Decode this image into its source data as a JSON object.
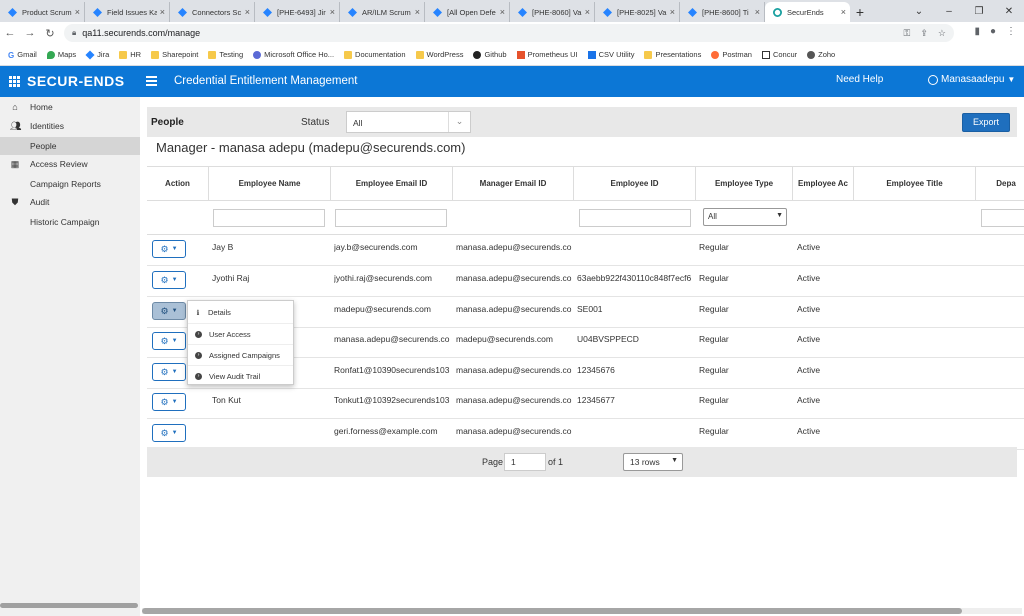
{
  "browser": {
    "tabs": [
      {
        "title": "Product Scrum"
      },
      {
        "title": "Field Issues Ka"
      },
      {
        "title": "Connectors Sc"
      },
      {
        "title": "[PHE-6493] Jir"
      },
      {
        "title": "AR/ILM Scrum"
      },
      {
        "title": "[All Open Defe"
      },
      {
        "title": "[PHE-8060] Va"
      },
      {
        "title": "[PHE-8025] Va"
      },
      {
        "title": "[PHE-8600] Ti"
      },
      {
        "title": "SecurEnds"
      }
    ],
    "url": "qa11.securends.com/manage",
    "bookmarks": [
      "Gmail",
      "Maps",
      "Jira",
      "HR",
      "Sharepoint",
      "Testing",
      "Microsoft Office Ho...",
      "Documentation",
      "WordPress",
      "Github",
      "Prometheus UI",
      "CSV Utility",
      "Presentations",
      "Postman",
      "Concur",
      "Zoho"
    ]
  },
  "header": {
    "logo": "SECUR-ENDS",
    "title": "Credential Entitlement Management",
    "help": "Need Help",
    "user": "Manasaadepu",
    "color": "#0c77d6"
  },
  "sidebar": {
    "items": [
      {
        "label": "Home",
        "icon": "home-icon",
        "level": "head"
      },
      {
        "label": "Identities",
        "icon": "users-icon",
        "level": "head"
      },
      {
        "label": "People",
        "level": "sub",
        "active": true
      },
      {
        "label": "Access Review",
        "icon": "grid-icon",
        "level": "head"
      },
      {
        "label": "Campaign Reports",
        "level": "sub"
      },
      {
        "label": "Audit",
        "icon": "shield-icon",
        "level": "head"
      },
      {
        "label": "Historic Campaign",
        "level": "sub"
      }
    ]
  },
  "filterbar": {
    "title": "People",
    "status_label": "Status",
    "status_value": "All",
    "export_label": "Export"
  },
  "manager_title": "Manager - manasa adepu (madepu@securends.com)",
  "table": {
    "columns": [
      "Action",
      "Employee Name",
      "Employee Email ID",
      "Manager Email ID",
      "Employee ID",
      "Employee Type",
      "Employee Ac",
      "Employee Title",
      "Depa"
    ],
    "type_filter": "All",
    "rows": [
      {
        "name": "Jay B",
        "email": "jay.b@securends.com",
        "manager": "manasa.adepu@securends.co",
        "emp_id": "",
        "type": "Regular",
        "status": "Active"
      },
      {
        "name": "Jyothi Raj",
        "email": "jyothi.raj@securends.com",
        "manager": "manasa.adepu@securends.co",
        "emp_id": "63aebb922f430110c848f7ecf6",
        "type": "Regular",
        "status": "Active"
      },
      {
        "name": "",
        "email": "madepu@securends.com",
        "manager": "manasa.adepu@securends.co",
        "emp_id": "SE001",
        "type": "Regular",
        "status": "Active"
      },
      {
        "name": "",
        "email": "manasa.adepu@securends.co",
        "manager": "madepu@securends.com",
        "emp_id": "U04BVSPPECD",
        "type": "Regular",
        "status": "Active"
      },
      {
        "name": "",
        "email": "Ronfat1@10390securends103",
        "manager": "manasa.adepu@securends.co",
        "emp_id": "12345676",
        "type": "Regular",
        "status": "Active"
      },
      {
        "name": "Ton Kut",
        "email": "Tonkut1@10392securends103",
        "manager": "manasa.adepu@securends.co",
        "emp_id": "12345677",
        "type": "Regular",
        "status": "Active"
      },
      {
        "name": "",
        "email": "geri.forness@example.com",
        "manager": "manasa.adepu@securends.co",
        "emp_id": "",
        "type": "Regular",
        "status": "Active"
      }
    ]
  },
  "action_menu": {
    "items": [
      {
        "label": "Details",
        "icon": "info-icon"
      },
      {
        "label": "User Access",
        "icon": "circle-icon"
      },
      {
        "label": "Assigned Campaigns",
        "icon": "circle-icon"
      },
      {
        "label": "View Audit Trail",
        "icon": "circle-icon"
      }
    ]
  },
  "pager": {
    "page_label": "Page",
    "page_value": "1",
    "of_label": "of 1",
    "rows_value": "13 rows"
  }
}
